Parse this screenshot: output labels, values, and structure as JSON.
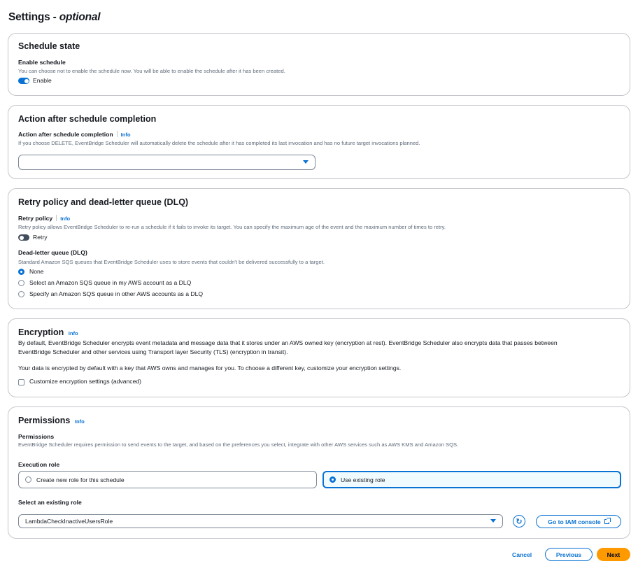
{
  "page": {
    "title": "Settings",
    "title_suffix": "- optional"
  },
  "schedule_state": {
    "title": "Schedule state",
    "label": "Enable schedule",
    "description": "You can choose not to enable the schedule now. You will be able to enable the schedule after it has been created.",
    "toggle_label": "Enable",
    "toggle_on": true
  },
  "action_after_completion": {
    "title": "Action after schedule completion",
    "label": "Action after schedule completion",
    "info": "Info",
    "description": "If you choose DELETE, EventBridge Scheduler will automatically delete the schedule after it has completed its last invocation and has no future target invocations planned.",
    "selected_value": ""
  },
  "retry": {
    "title": "Retry policy and dead-letter queue (DLQ)",
    "policy_label": "Retry policy",
    "info": "Info",
    "policy_description": "Retry policy allows EventBridge Scheduler to re-run a schedule if it fails to invoke its target. You can specify the maximum age of the event and the maximum number of times to retry.",
    "toggle_label": "Retry",
    "toggle_on": false,
    "dlq_label": "Dead-letter queue (DLQ)",
    "dlq_description": "Standard Amazon SQS queues that EventBridge Scheduler uses to store events that couldn't be delivered successfully to a target.",
    "options": [
      "None",
      "Select an Amazon SQS queue in my AWS account as a DLQ",
      "Specify an Amazon SQS queue in other AWS accounts as a DLQ"
    ],
    "selected_index": 0
  },
  "encryption": {
    "title": "Encryption",
    "info": "Info",
    "description_line1": "By default, EventBridge Scheduler encrypts event metadata and message data that it stores under an AWS owned key (encryption at rest). EventBridge Scheduler also encrypts data that passes between",
    "description_line2": "EventBridge Scheduler and other services using Transport layer Security (TLS) (encryption in transit).",
    "note": "Your data is encrypted by default with a key that AWS owns and manages for you. To choose a different key, customize your encryption settings.",
    "checkbox_label": "Customize encryption settings (advanced)"
  },
  "permissions": {
    "title": "Permissions",
    "info": "Info",
    "label": "Permissions",
    "description": "EventBridge Scheduler requires permission to send events to the target, and based on the preferences you select, integrate with other AWS services such as AWS KMS and Amazon SQS.",
    "execution_role_label": "Execution role",
    "role_options": [
      "Create new role for this schedule",
      "Use existing role"
    ],
    "selected_role_option": 1,
    "existing_role_label": "Select an existing role",
    "existing_role_value": "LambdaCheckInactiveUsersRole",
    "iam_button": "Go to IAM console"
  },
  "footer": {
    "cancel": "Cancel",
    "previous": "Previous",
    "next": "Next"
  },
  "colors": {
    "accent": "#0972d3",
    "primary_button": "#ff9900",
    "border": "#c6c6cd"
  }
}
